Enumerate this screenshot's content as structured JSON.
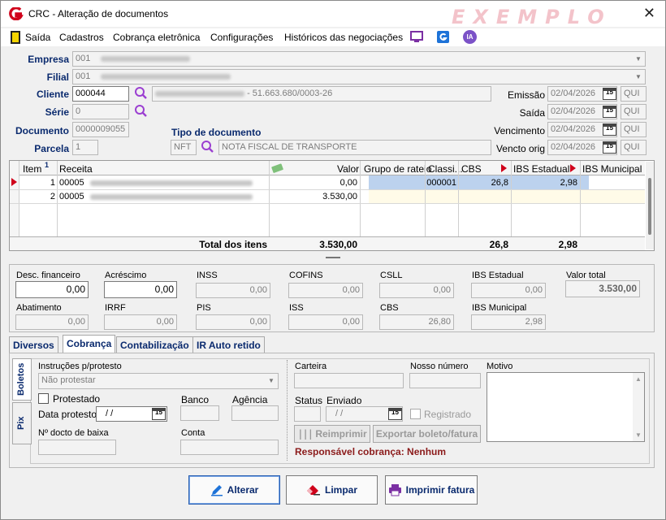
{
  "window": {
    "title": "CRC - Alteração de documentos",
    "watermark": "EXEMPLO",
    "close": "✕"
  },
  "menu": {
    "items": [
      "Saída",
      "Cadastros",
      "Cobrança eletrônica",
      "Configurações",
      "Históricos das negociações"
    ],
    "ia_label": "IA"
  },
  "header": {
    "empresa": {
      "label": "Empresa",
      "code": "001"
    },
    "filial": {
      "label": "Filial",
      "code": "001"
    },
    "cliente": {
      "label": "Cliente",
      "code": "000044",
      "cnpj": "- 51.663.680/0003-26"
    },
    "serie": {
      "label": "Série",
      "value": "0"
    },
    "documento": {
      "label": "Documento",
      "value": "0000009055"
    },
    "parcela": {
      "label": "Parcela",
      "value": "1"
    },
    "tipo_doc": {
      "label": "Tipo de documento",
      "code": "NFT",
      "description": "NOTA FISCAL DE TRANSPORTE"
    },
    "dates": [
      {
        "label": "Emissão",
        "value": "02/04/2026",
        "day": "QUI"
      },
      {
        "label": "Saída",
        "value": "02/04/2026",
        "day": "QUI"
      },
      {
        "label": "Vencimento",
        "value": "02/04/2026",
        "day": "QUI"
      },
      {
        "label": "Vencto orig",
        "value": "02/04/2026",
        "day": "QUI"
      }
    ],
    "calendar_icon_text": "15"
  },
  "grid": {
    "columns": [
      "Item",
      "Receita",
      "Valor",
      "Grupo de rateio",
      "Classi...",
      "CBS",
      "IBS Estadual",
      "IBS Municipal"
    ],
    "sort_badge": "1",
    "rows": [
      {
        "item": "1",
        "receita_code": "00005",
        "valor": "0,00",
        "grupo": "",
        "classi": "000001",
        "cbs": "26,8",
        "ibs_est": "2,98",
        "ibs_mun": ""
      },
      {
        "item": "2",
        "receita_code": "00005",
        "valor": "3.530,00",
        "grupo": "",
        "classi": "",
        "cbs": "",
        "ibs_est": "",
        "ibs_mun": ""
      }
    ],
    "total_label": "Total dos itens",
    "total_valor": "3.530,00",
    "total_cbs": "26,8",
    "total_ibs_est": "2,98"
  },
  "totals": {
    "desc_financeiro": {
      "label": "Desc. financeiro",
      "value": "0,00"
    },
    "acrescimo": {
      "label": "Acréscimo",
      "value": "0,00"
    },
    "inss": {
      "label": "INSS",
      "value": "0,00"
    },
    "cofins": {
      "label": "COFINS",
      "value": "0,00"
    },
    "csll": {
      "label": "CSLL",
      "value": "0,00"
    },
    "ibs_estadual": {
      "label": "IBS Estadual",
      "value": "0,00"
    },
    "valor_total": {
      "label": "Valor total",
      "value": "3.530,00"
    },
    "abatimento": {
      "label": "Abatimento",
      "value": "0,00"
    },
    "irrf": {
      "label": "IRRF",
      "value": "0,00"
    },
    "pis": {
      "label": "PIS",
      "value": "0,00"
    },
    "iss": {
      "label": "ISS",
      "value": "0,00"
    },
    "cbs": {
      "label": "CBS",
      "value": "26,80"
    },
    "ibs_municipal": {
      "label": "IBS Municipal",
      "value": "2,98"
    }
  },
  "tabs": [
    "Diversos",
    "Cobrança",
    "Contabilização",
    "IR Auto retido"
  ],
  "side_tabs": [
    "Boletos",
    "Pix"
  ],
  "cobranca": {
    "instrucoes_label": "Instruções p/protesto",
    "instrucoes_value": "Não protestar",
    "protestado_label": "Protestado",
    "data_protesto_label": "Data protesto:",
    "data_protesto_value": "/ /",
    "banco_label": "Banco",
    "agencia_label": "Agência",
    "n_docto_baixa_label": "Nº docto de baixa",
    "conta_label": "Conta",
    "carteira_label": "Carteira",
    "nosso_numero_label": "Nosso número",
    "motivo_label": "Motivo",
    "status_label": "Status",
    "enviado_label": "Enviado",
    "enviado_value": "/ /",
    "registrado_label": "Registrado",
    "reimprimir_label": "Reimprimir",
    "exportar_label": "Exportar boleto/fatura",
    "responsavel": "Responsável cobrança: Nenhum"
  },
  "actions": {
    "alterar": "Alterar",
    "limpar": "Limpar",
    "imprimir": "Imprimir fatura"
  },
  "colors": {
    "label_blue": "#0a2a6e",
    "accent_red": "#d0021b",
    "selection": "#bcd2ee",
    "purple": "#7b2fa3"
  }
}
